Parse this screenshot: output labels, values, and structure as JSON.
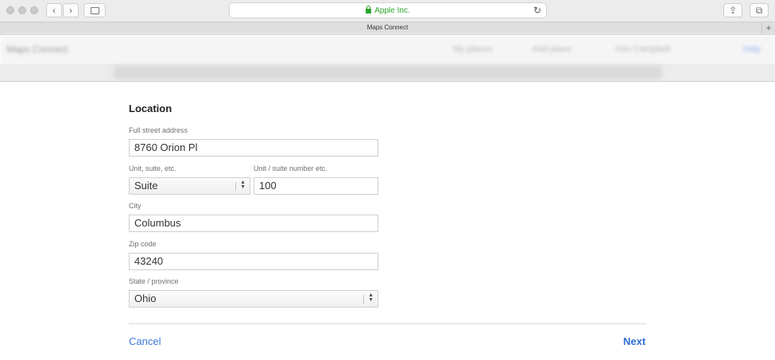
{
  "browser": {
    "url_text": "Apple Inc.",
    "tab_title": "Maps Connect"
  },
  "header": {
    "logo": "Maps Connect",
    "items": [
      "My places",
      "Add place",
      "Kim Campbell"
    ],
    "help": "Help"
  },
  "form": {
    "title": "Location",
    "street": {
      "label": "Full street address",
      "value": "8760 Orion Pl"
    },
    "unit_type": {
      "label": "Unit, suite, etc.",
      "value": "Suite"
    },
    "unit_number": {
      "label": "Unit / suite number etc.",
      "value": "100"
    },
    "city": {
      "label": "City",
      "value": "Columbus"
    },
    "zip": {
      "label": "Zip code",
      "value": "43240"
    },
    "state": {
      "label": "State / province",
      "value": "Ohio"
    }
  },
  "actions": {
    "cancel": "Cancel",
    "next": "Next"
  },
  "colors": {
    "link": "#3a78d8",
    "secure": "#2aa52a"
  }
}
